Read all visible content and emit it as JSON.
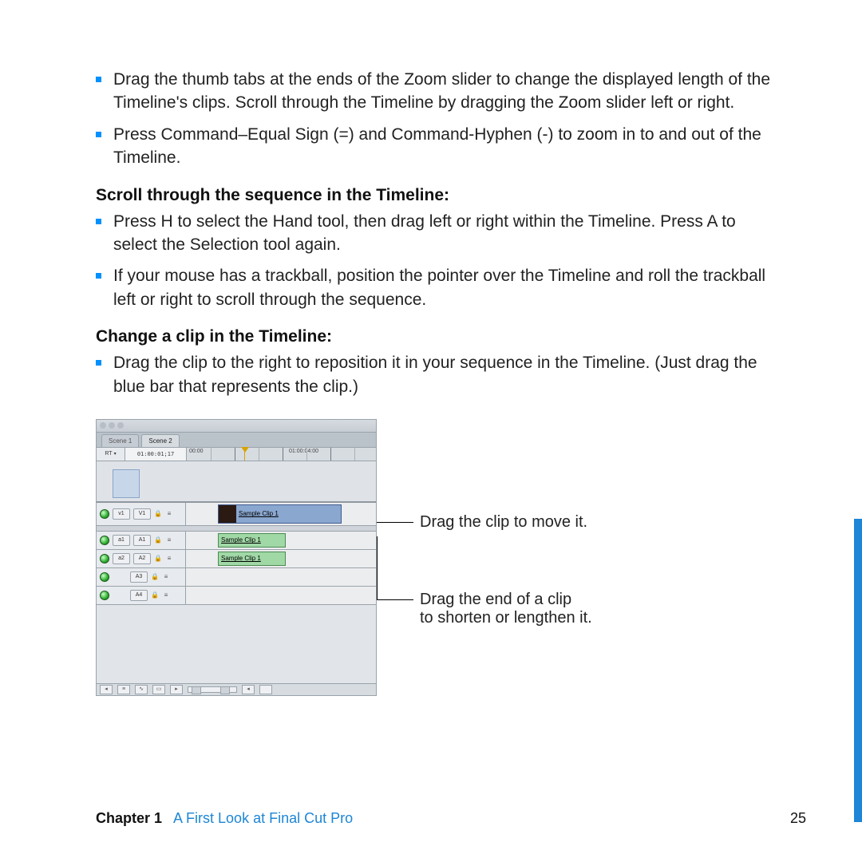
{
  "body": {
    "topBullets": [
      "Drag the thumb tabs at the ends of the Zoom slider to change the displayed length of the Timeline's clips. Scroll through the Timeline by dragging the Zoom slider left or right.",
      "Press Command–Equal Sign (=) and Command-Hyphen (-) to zoom in to and out of the Timeline."
    ],
    "heading1": "Scroll through the sequence in the Timeline:",
    "bullets1": [
      "Press H to select the Hand tool, then drag left or right within the Timeline. Press A to select the Selection tool again.",
      "If your mouse has a trackball, position the pointer over the Timeline and roll the trackball left or right to scroll through the sequence."
    ],
    "heading2": "Change a clip in the Timeline:",
    "bullets2": [
      "Drag the clip to the right to reposition it in your sequence in the Timeline. (Just drag the blue bar that represents the clip.)"
    ]
  },
  "timeline": {
    "tabs": [
      "Scene 1",
      "Scene 2"
    ],
    "rt": "RT",
    "timecode": "01:00:01;17",
    "rulerStart": "00:00",
    "rulerEnd": "01:00:04:00",
    "tracks": {
      "v1_src": "v1",
      "v1_dst": "V1",
      "a1_src": "a1",
      "a1_dst": "A1",
      "a2_src": "a2",
      "a2_dst": "A2",
      "a3": "A3",
      "a4": "A4"
    },
    "clip_video": "Sample Clip 1",
    "clip_audio1": "Sample Clip 1",
    "clip_audio2": "Sample Clip 1"
  },
  "callouts": {
    "c1": "Drag the clip to move it.",
    "c2a": "Drag the end of a clip",
    "c2b": "to shorten or lengthen it."
  },
  "footer": {
    "chapter": "Chapter 1",
    "title": "A First Look at Final Cut Pro",
    "page": "25"
  }
}
